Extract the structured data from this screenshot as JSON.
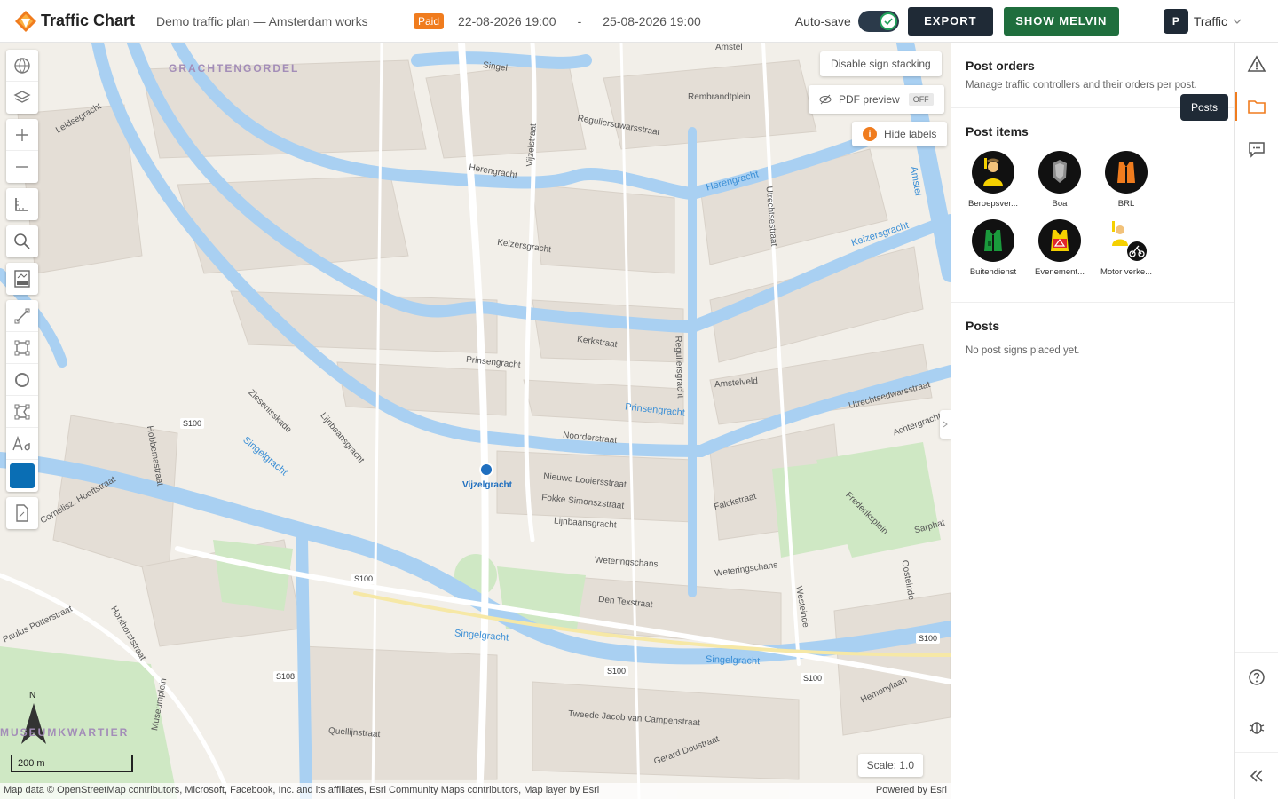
{
  "brand": {
    "name": "Traffic Chart"
  },
  "plan": {
    "title": "Demo traffic plan — Amsterdam works",
    "status": "Paid",
    "start": "22-08-2026 19:00",
    "separator": "-",
    "end": "25-08-2026 19:00"
  },
  "header": {
    "autosave_label": "Auto-save",
    "export_label": "EXPORT",
    "melvin_label": "SHOW MELVIN",
    "user_initial": "P",
    "user_name": "Traffic"
  },
  "map": {
    "disable_stacking": "Disable sign stacking",
    "pdf_preview": "PDF preview",
    "pdf_state": "OFF",
    "hide_labels": "Hide labels",
    "info_mark": "i",
    "scale_bar": "200 m",
    "scale": "Scale: 1.0",
    "north": "N",
    "attribution": "Map data © OpenStreetMap contributors, Microsoft, Facebook, Inc. and its affiliates, Esri Community Maps contributors, Map layer by Esri",
    "powered_by": "Powered by Esri",
    "station": "Vijzelgracht",
    "labels": {
      "grachtengordel": "GRACHTENGORDEL",
      "museumkwartier": "MUSEUMKWARTIER",
      "herengracht": "Herengracht",
      "keizersgracht": "Keizersgracht",
      "prinsengracht": "Prinsengracht",
      "singelgracht": "Singelgracht",
      "singel": "Singel",
      "vijzelstraat": "Vijzelstraat",
      "reguliersgracht": "Reguliersgracht",
      "weteringschans": "Weteringschans",
      "noorderstraat": "Noorderstraat",
      "kerkstraat": "Kerkstraat",
      "amstel": "Amstel",
      "utrechtsestraat": "Utrechtsestraat",
      "denTexstraat": "Den Texstraat",
      "leidsegracht": "Leidsegracht",
      "lijnbaansgracht": "Lijnbaansgracht",
      "nieuweLooiersstraat": "Nieuwe Looiersstraat",
      "fokkeSimonszstraat": "Fokke Simonszstraat",
      "lijnbaansgracht2": "Lijnbaansgracht",
      "hobbemastraat": "Hobbemastraat",
      "rembrandtplein": "Rembrandtplein",
      "amstelveld": "Amstelveld",
      "s100": "S100",
      "s108": "S108",
      "quellijnstraat": "Quellijnstraat",
      "tweedeJacob": "Tweede Jacob van Campenstraat",
      "ferdinand": "Frederiksplein",
      "sarphati": "Sarphat",
      "westeinde": "Westeinde",
      "oosteinde": "Oosteinde",
      "hemonylaan": "Hemonylaan",
      "falckstraat": "Falckstraat",
      "paulus": "Paulus Potterstraat",
      "achtergracht": "Achtergracht",
      "utrechtsedwars": "Utrechtsedwarsstraat",
      "reguliersdwars": "Reguliersdwarsstraat",
      "corneliszHooft": "Cornelisz. Hooftstraat",
      "museumplein": "Museumplein",
      "honthorst": "Honthorststraat",
      "geerard": "Gerard Doustraat",
      "ziesenis": "Ziesenisskade"
    }
  },
  "panel": {
    "title": "Post orders",
    "subtitle": "Manage traffic controllers and their orders per post.",
    "items_title": "Post items",
    "items": [
      {
        "label": "Beroepsver...",
        "icon": "professional-controller-icon"
      },
      {
        "label": "Boa",
        "icon": "boa-icon"
      },
      {
        "label": "BRL",
        "icon": "brl-vest-icon"
      },
      {
        "label": "Buitendienst",
        "icon": "field-service-vest-icon"
      },
      {
        "label": "Evenement...",
        "icon": "event-vest-icon"
      },
      {
        "label": "Motor verke...",
        "icon": "motorcycle-controller-icon"
      }
    ],
    "posts_title": "Posts",
    "posts_empty": "No post signs placed yet."
  },
  "rail": {
    "tooltip": "Posts"
  },
  "colors": {
    "accent": "#f07c1e",
    "dark": "#1f2a36",
    "green": "#1f6e3d",
    "water": "#a9d0f2",
    "park": "#cfe8c4",
    "selected_color": "#0a6eb4"
  }
}
